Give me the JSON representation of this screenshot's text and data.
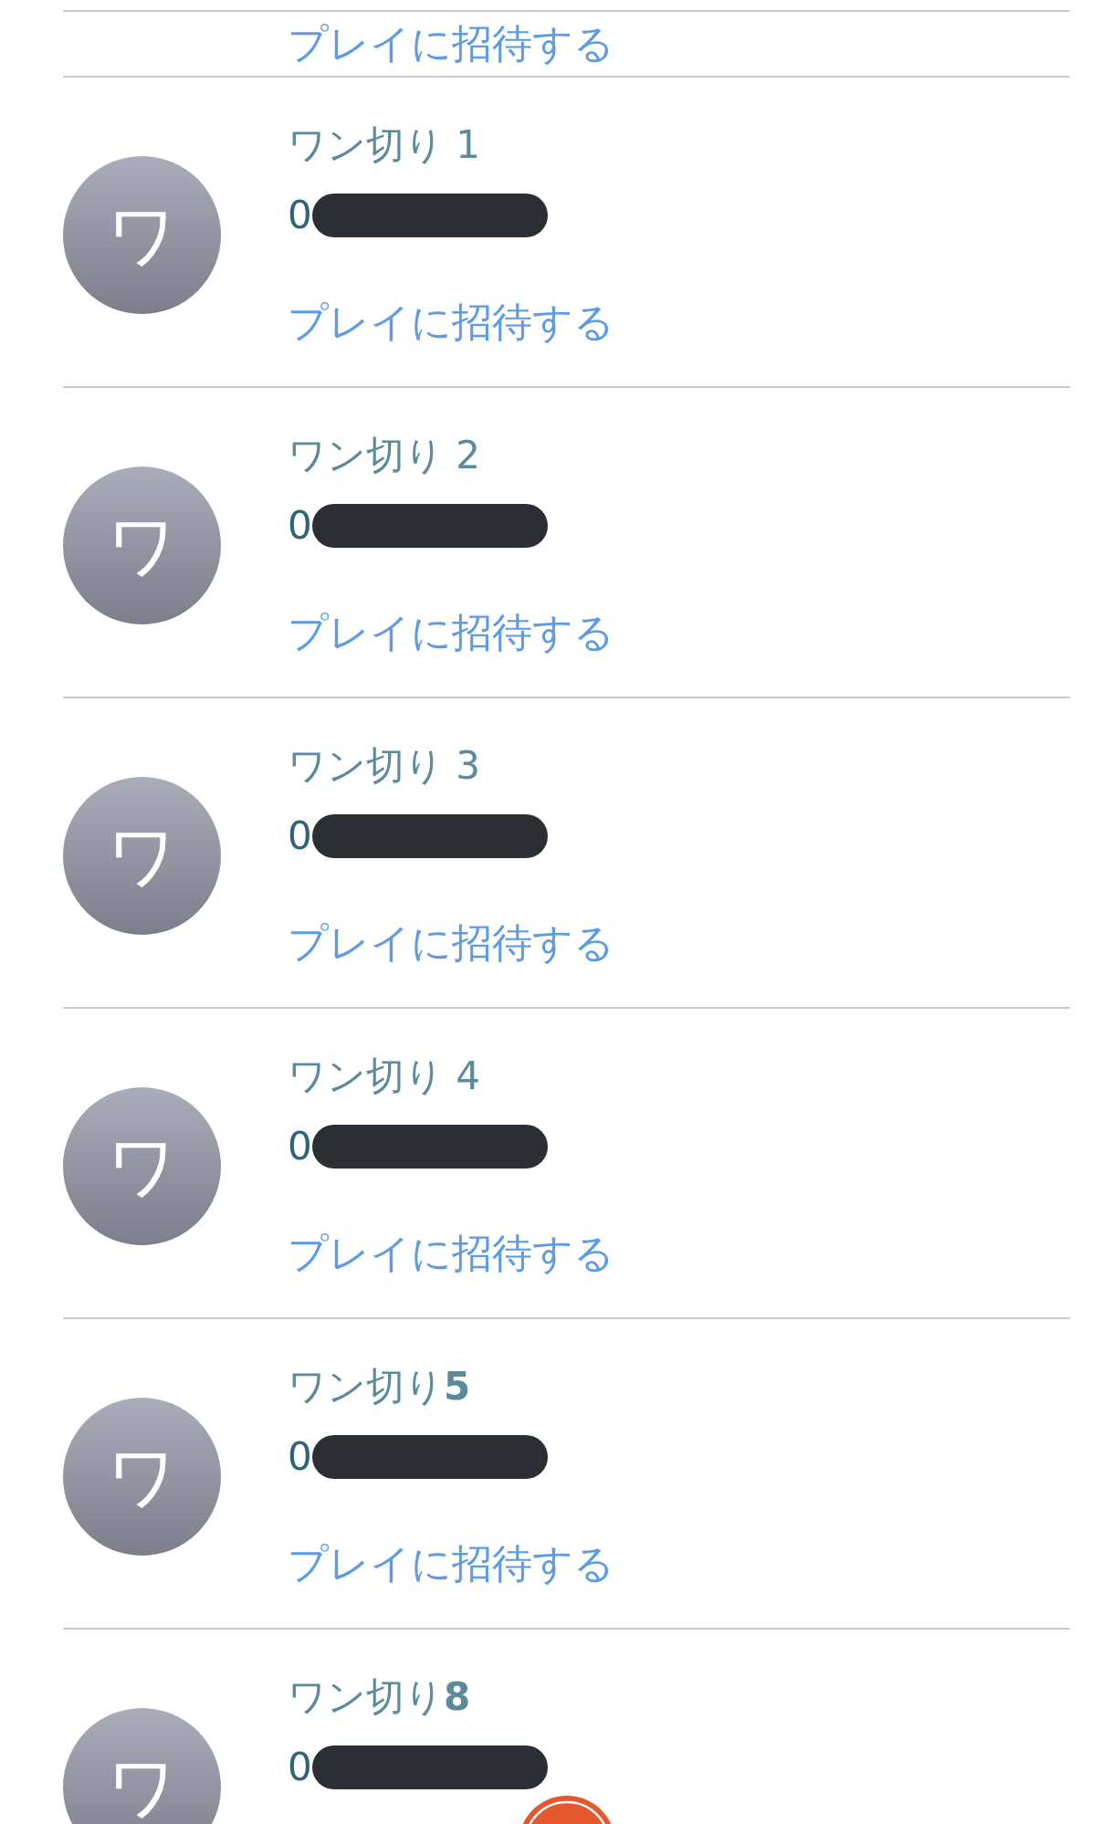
{
  "top_partial_row": {
    "invite_link": "プレイに招待する"
  },
  "contacts": [
    {
      "avatar_initial": "ワ",
      "name": "ワン切り 1",
      "phone": "0",
      "invite_link": "プレイに招待する"
    },
    {
      "avatar_initial": "ワ",
      "name": "ワン切り 2",
      "phone": "0",
      "invite_link": "プレイに招待する"
    },
    {
      "avatar_initial": "ワ",
      "name": "ワン切り 3",
      "phone": "0",
      "invite_link": "プレイに招待する"
    },
    {
      "avatar_initial": "ワ",
      "name": "ワン切り 4",
      "phone": "0",
      "invite_link": "プレイに招待する"
    },
    {
      "avatar_initial": "ワ",
      "name": "ワン切り**5**",
      "phone": "0",
      "invite_link": "プレイに招待する"
    },
    {
      "avatar_initial": "ワ",
      "name": "ワン切り**8**",
      "phone": "0"
    }
  ]
}
